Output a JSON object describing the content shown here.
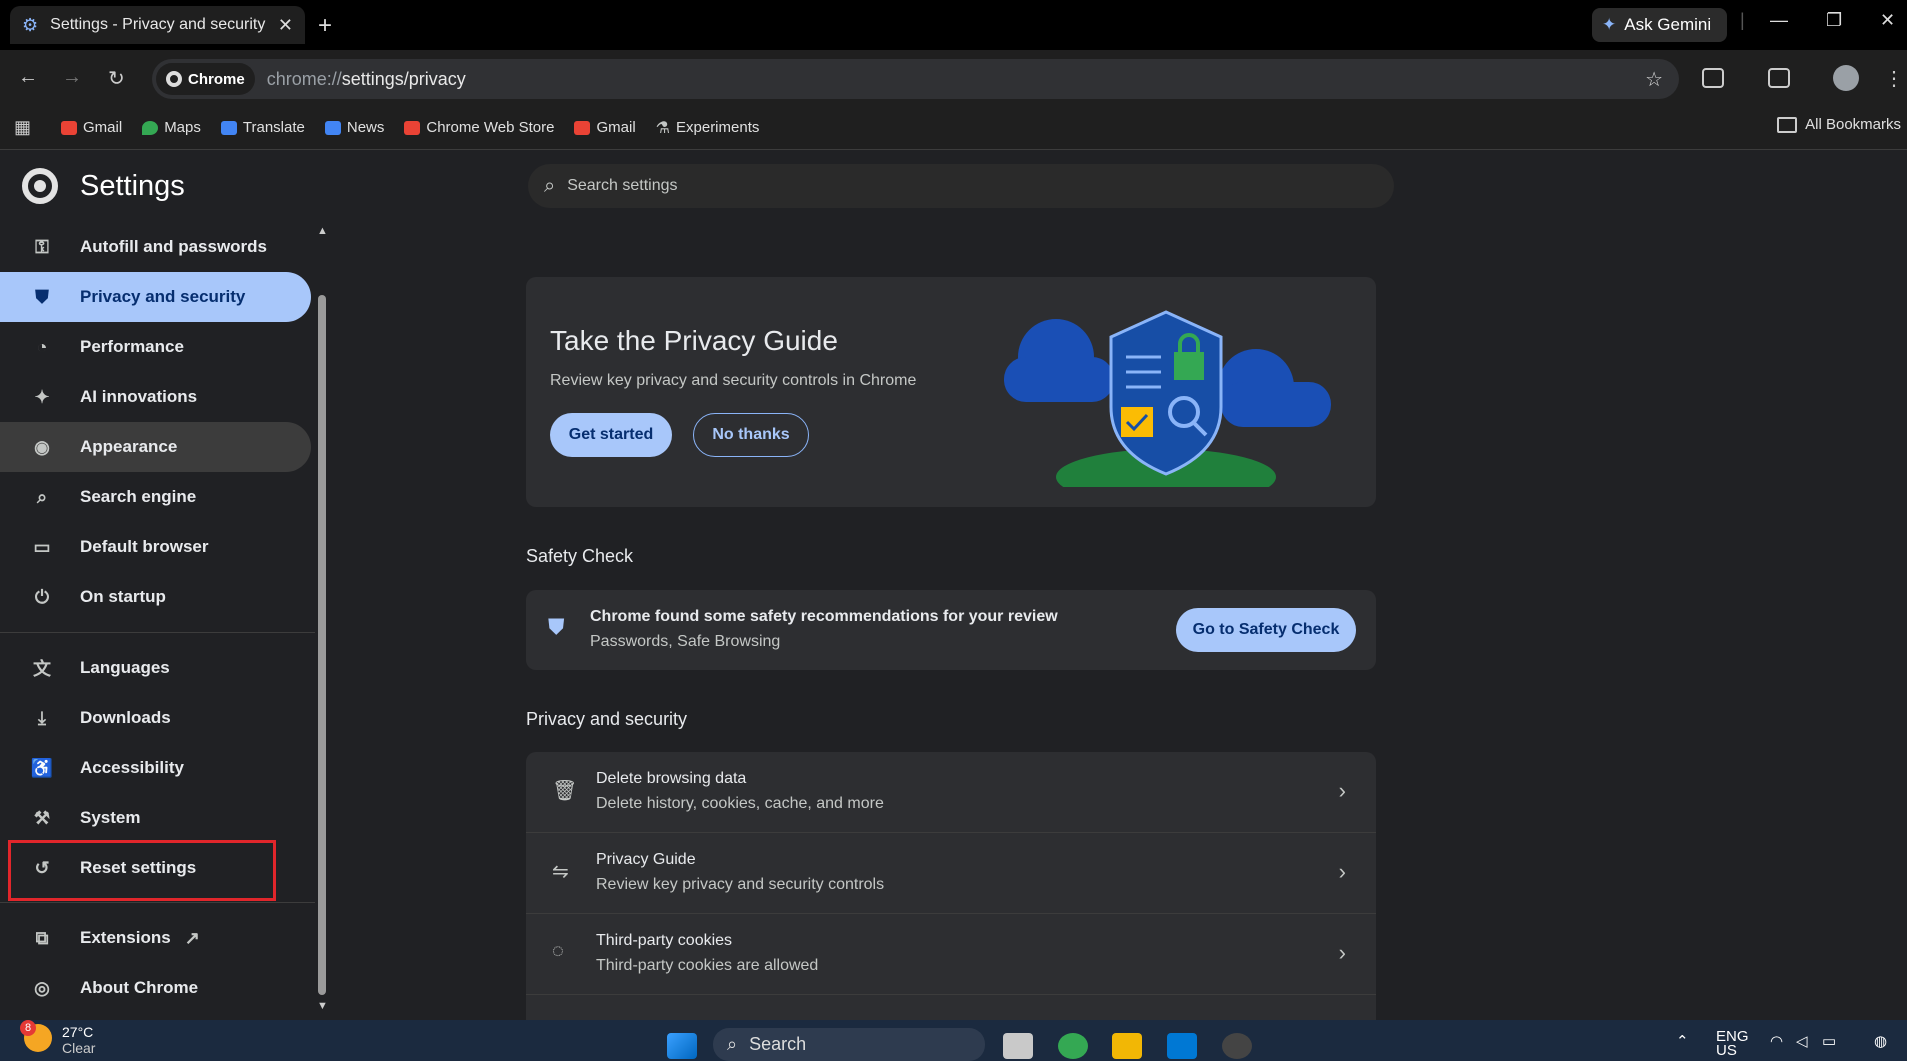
{
  "browser": {
    "tab_title": "Settings - Privacy and security",
    "tab_close": "✕",
    "new_tab": "+",
    "gemini_label": "Ask Gemini",
    "chip_label": "Chrome",
    "url_prefix": "chrome://",
    "url_rest": "settings/privacy",
    "all_bookmarks": "All Bookmarks"
  },
  "bookmarks": [
    {
      "label": "Gmail",
      "color": "#ea4335"
    },
    {
      "label": "Maps",
      "color": "#34a853"
    },
    {
      "label": "Translate",
      "color": "#4285f4"
    },
    {
      "label": "News",
      "color": "#4285f4"
    },
    {
      "label": "Chrome Web Store",
      "color": "#ea4335"
    },
    {
      "label": "Gmail",
      "color": "#ea4335"
    },
    {
      "label": "Experiments",
      "color": "#c4c7c5"
    }
  ],
  "sidebar": {
    "title": "Settings",
    "items": [
      {
        "label": "Autofill and passwords",
        "icon": "key-icon"
      },
      {
        "label": "Privacy and security",
        "icon": "shield-icon"
      },
      {
        "label": "Performance",
        "icon": "speedometer-icon"
      },
      {
        "label": "AI innovations",
        "icon": "sparkle-icon"
      },
      {
        "label": "Appearance",
        "icon": "palette-icon"
      },
      {
        "label": "Search engine",
        "icon": "search-icon"
      },
      {
        "label": "Default browser",
        "icon": "browser-icon"
      },
      {
        "label": "On startup",
        "icon": "power-icon"
      },
      {
        "label": "Languages",
        "icon": "translate-icon"
      },
      {
        "label": "Downloads",
        "icon": "download-icon"
      },
      {
        "label": "Accessibility",
        "icon": "accessibility-icon"
      },
      {
        "label": "System",
        "icon": "wrench-icon"
      },
      {
        "label": "Reset settings",
        "icon": "reset-icon"
      },
      {
        "label": "Extensions",
        "icon": "puzzle-icon"
      },
      {
        "label": "About Chrome",
        "icon": "chrome-icon"
      }
    ]
  },
  "search": {
    "placeholder": "Search settings"
  },
  "privacy_guide": {
    "title": "Take the Privacy Guide",
    "subtitle": "Review key privacy and security controls in Chrome",
    "primary": "Get started",
    "secondary": "No thanks"
  },
  "safety_check": {
    "heading": "Safety Check",
    "title": "Chrome found some safety recommendations for your review",
    "subtitle": "Passwords, Safe Browsing",
    "button": "Go to Safety Check"
  },
  "privacy_section": {
    "heading": "Privacy and security",
    "rows": [
      {
        "title": "Delete browsing data",
        "subtitle": "Delete history, cookies, cache, and more",
        "icon": "trash-icon"
      },
      {
        "title": "Privacy Guide",
        "subtitle": "Review key privacy and security controls",
        "icon": "signpost-icon"
      },
      {
        "title": "Third-party cookies",
        "subtitle": "Third-party cookies are allowed",
        "icon": "cookie-icon"
      }
    ]
  },
  "taskbar": {
    "weather_temp": "27°C",
    "weather_desc": "Clear",
    "weather_badge": "8",
    "search_label": "Search",
    "lang": "ENG",
    "region": "US"
  },
  "colors": {
    "accent": "#a8c7fa",
    "highlight": "#e1262b"
  }
}
